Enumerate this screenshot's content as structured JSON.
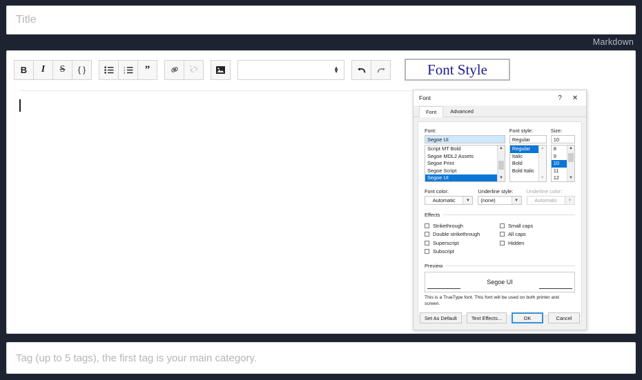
{
  "editor": {
    "title_placeholder": "Title",
    "mode_label": "Markdown",
    "tag_placeholder": "Tag (up to 5 tags), the first tag is your main category.",
    "font_style_button": "Font Style",
    "format_select_value": "",
    "toolbar": [
      {
        "name": "bold-button",
        "glyph": "B",
        "kind": "bold"
      },
      {
        "name": "italic-button",
        "glyph": "I",
        "kind": "italic"
      },
      {
        "name": "strikethrough-button",
        "glyph": "S",
        "kind": "strike"
      },
      {
        "name": "code-button",
        "glyph": "{}",
        "kind": "braces"
      },
      {
        "name": "bullet-list-button",
        "glyph": "",
        "kind": "ul"
      },
      {
        "name": "numbered-list-button",
        "glyph": "",
        "kind": "ol"
      },
      {
        "name": "quote-button",
        "glyph": "\"",
        "kind": "quote"
      },
      {
        "name": "link-button",
        "glyph": "",
        "kind": "link"
      },
      {
        "name": "unlink-button",
        "glyph": "",
        "kind": "unlink"
      },
      {
        "name": "image-button",
        "glyph": "",
        "kind": "image"
      },
      {
        "name": "undo-button",
        "glyph": "",
        "kind": "undo"
      },
      {
        "name": "redo-button",
        "glyph": "",
        "kind": "redo"
      }
    ]
  },
  "font_dialog": {
    "title": "Font",
    "help_icon": "?",
    "close_icon": "✕",
    "tabs": [
      {
        "label": "Font",
        "active": true
      },
      {
        "label": "Advanced",
        "active": false
      }
    ],
    "font": {
      "label": "Font:",
      "value": "Segoe UI",
      "options": [
        "Script MT Bold",
        "Segoe MDL2 Assets",
        "Segoe Print",
        "Segoe Script",
        "Segoe UI"
      ],
      "selected": "Segoe UI"
    },
    "font_style": {
      "label": "Font style:",
      "value": "Regular",
      "options": [
        "Regular",
        "Italic",
        "Bold",
        "Bold Italic"
      ],
      "selected": "Regular"
    },
    "size": {
      "label": "Size:",
      "value": "10",
      "options": [
        "8",
        "9",
        "10",
        "11",
        "12"
      ],
      "selected": "10"
    },
    "font_color": {
      "label": "Font color:",
      "value": "Automatic"
    },
    "underline_style": {
      "label": "Underline style:",
      "value": "(none)"
    },
    "underline_color": {
      "label": "Underline color:",
      "value": "Automatic",
      "disabled": true
    },
    "effects": {
      "label": "Effects",
      "left": [
        {
          "label": "Strikethrough",
          "checked": false
        },
        {
          "label": "Double strikethrough",
          "checked": false
        },
        {
          "label": "Superscript",
          "checked": false
        },
        {
          "label": "Subscript",
          "checked": false
        }
      ],
      "right": [
        {
          "label": "Small caps",
          "checked": false
        },
        {
          "label": "All caps",
          "checked": false
        },
        {
          "label": "Hidden",
          "checked": false
        }
      ]
    },
    "preview": {
      "label": "Preview",
      "sample_text": "Segoe UI",
      "note": "This is a TrueType font. This font will be used on both printer and screen."
    },
    "buttons": {
      "set_as_default": "Set As Default",
      "text_effects": "Text Effects...",
      "ok": "OK",
      "cancel": "Cancel"
    }
  },
  "colors": {
    "background": "#1d2330",
    "accent_blue": "#0b76d6",
    "font_style_text": "#1b1b8f",
    "placeholder": "#b5b5b5"
  }
}
